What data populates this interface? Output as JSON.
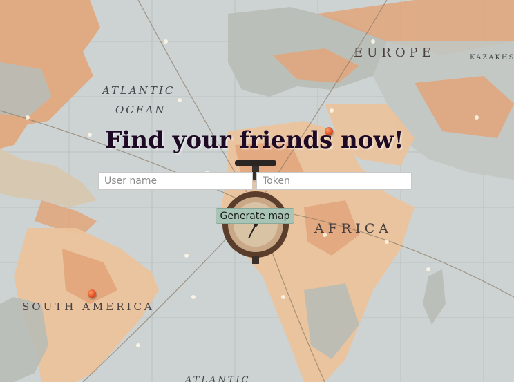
{
  "page": {
    "title": "Find your friends now!"
  },
  "form": {
    "username_placeholder": "User name",
    "token_placeholder": "Token",
    "generate_label": "Generate map"
  },
  "map_labels": {
    "atlantic": "ATLANTIC",
    "ocean": "OCEAN",
    "europe": "EUROPE",
    "africa": "AFRICA",
    "south_america": "SOUTH AMERICA",
    "atlantic_bottom": "ATLANTIC",
    "kazakhs": "KAZAKHS"
  },
  "colors": {
    "ocean": "#cdd3d3",
    "land_orange": "#e2a57a",
    "land_peach": "#ecc29a",
    "land_gray": "#b9bdb6",
    "button": "#a8c4b4",
    "title": "#1f0a26"
  }
}
